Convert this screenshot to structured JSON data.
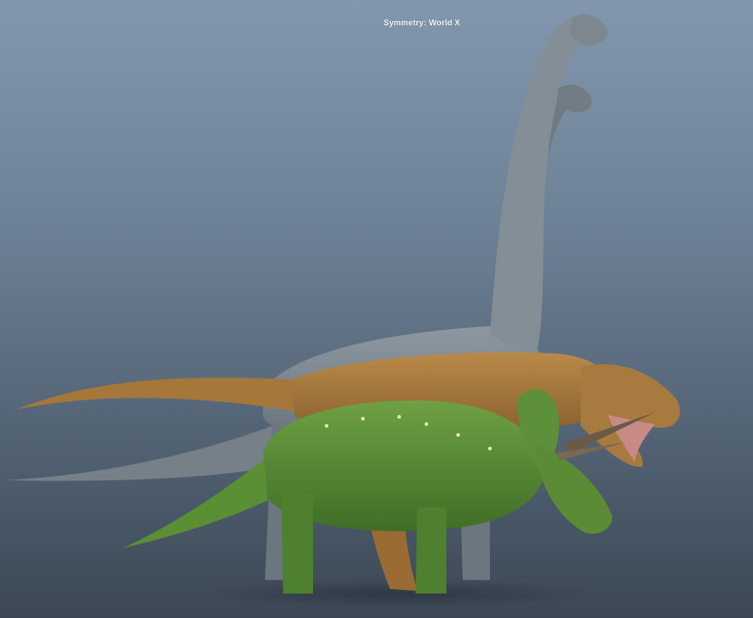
{
  "viewport": {
    "hud_text": "Symmetry: World X",
    "background_top": "#8297ad",
    "background_bottom": "#3b4754"
  },
  "models": [
    {
      "name": "brachiosaurus",
      "color": "#7f8a93"
    },
    {
      "name": "tyrannosaurus",
      "color": "#a97a3e"
    },
    {
      "name": "triceratops",
      "color": "#5e8f3a"
    }
  ]
}
